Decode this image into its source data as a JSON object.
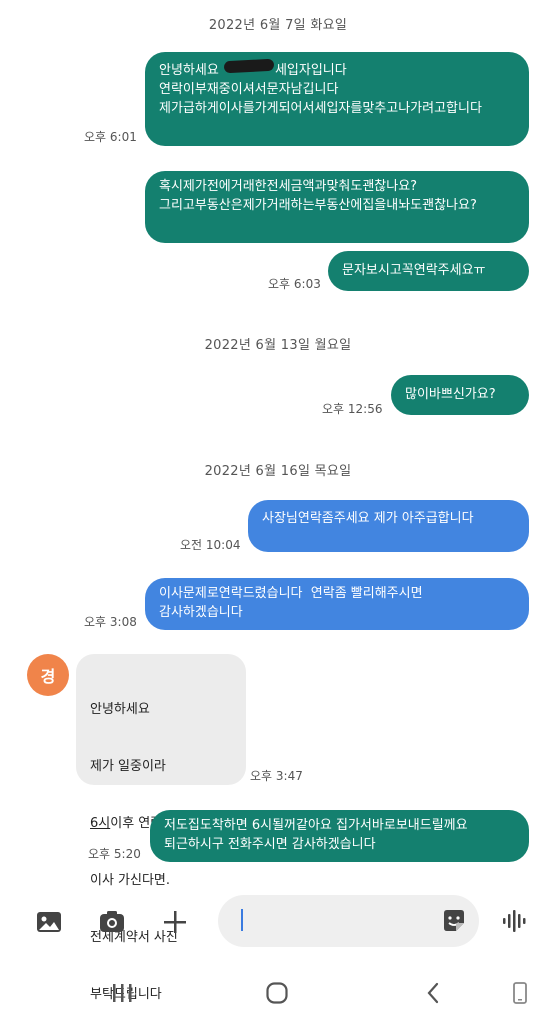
{
  "dates": {
    "d1": "2022년 6월 7일 화요일",
    "d2": "2022년 6월 13일 월요일",
    "d3": "2022년 6월 16일 목요일"
  },
  "messages": [
    {
      "side": "sent",
      "color": "green",
      "text_a": "안녕하세요 ",
      "text_b": "세입자입니다\n연락이부재중이셔서문자남깁니다\n제가급하게이사를가게되어서세입자를맞추고나가려고합니다",
      "time": "오후 6:01"
    },
    {
      "side": "sent",
      "color": "green",
      "text": "혹시제가전에거래한전세금액과맞춰도괜찮나요?\n그리고부동산은제가거래하는부동산에집을내놔도괜찮나요?",
      "time": ""
    },
    {
      "side": "sent",
      "color": "green",
      "text": "문자보시고꼭연락주세요ㅠ",
      "time": "오후 6:03"
    },
    {
      "side": "sent",
      "color": "green",
      "text": "많이바쁘신가요?",
      "time": "오후 12:56"
    },
    {
      "side": "sent",
      "color": "blue",
      "text": "사장님연락좀주세요 제가 아주급합니다",
      "time": "오전 10:04"
    },
    {
      "side": "sent",
      "color": "blue",
      "text": "이사문제로연락드렸습니다  연락좀 빨리해주시면\n감사하겠습니다",
      "time": "오후 3:08"
    },
    {
      "side": "received",
      "color": "gray",
      "avatar": "경",
      "line1": "안녕하세요",
      "line2": "제가 일중이라",
      "line3a": "6시",
      "line3b": "이후 연락드릴께요",
      "line4": "이사 가신다면.",
      "line5": "전세계약서 사진",
      "line6": "부탁드립니다",
      "time": "오후 3:47"
    },
    {
      "side": "sent",
      "color": "green",
      "text": "저도집도착하면 6시될꺼같아요 집가서바로보내드릴께요\n퇴근하시구 전화주시면 감사하겠습니다",
      "time": "오후 5:20"
    }
  ],
  "input": {
    "placeholder": "",
    "icons": [
      "gallery-icon",
      "camera-icon",
      "plus-icon",
      "sticker-icon",
      "voice-icon"
    ]
  },
  "navbar": {
    "icons": [
      "recent-apps-icon",
      "home-icon",
      "back-icon",
      "rotate-icon"
    ]
  },
  "colors": {
    "sent_green": "#14806f",
    "sent_blue": "#4285e0",
    "received_gray": "#ececec",
    "avatar": "#f0844a"
  }
}
